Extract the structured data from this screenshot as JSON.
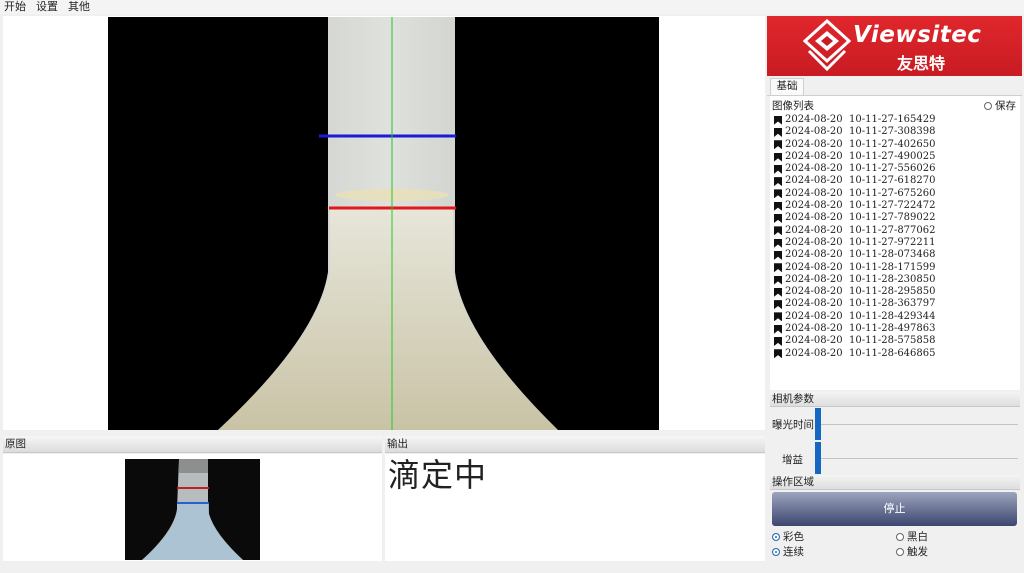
{
  "menu": {
    "items": [
      "开始",
      "设置",
      "其他"
    ]
  },
  "panels": {
    "original_label": "原图",
    "output_label": "输出"
  },
  "output": {
    "status_text": "滴定中"
  },
  "logo": {
    "text_en": "Viewsitec",
    "text_cn": "友思特"
  },
  "sidebar": {
    "tab_label": "基础",
    "image_list": {
      "title": "图像列表",
      "save_label": "保存",
      "items": [
        "2024-08-20  10-11-27-165429",
        "2024-08-20  10-11-27-308398",
        "2024-08-20  10-11-27-402650",
        "2024-08-20  10-11-27-490025",
        "2024-08-20  10-11-27-556026",
        "2024-08-20  10-11-27-618270",
        "2024-08-20  10-11-27-675260",
        "2024-08-20  10-11-27-722472",
        "2024-08-20  10-11-27-789022",
        "2024-08-20  10-11-27-877062",
        "2024-08-20  10-11-27-972211",
        "2024-08-20  10-11-28-073468",
        "2024-08-20  10-11-28-171599",
        "2024-08-20  10-11-28-230850",
        "2024-08-20  10-11-28-295850",
        "2024-08-20  10-11-28-363797",
        "2024-08-20  10-11-28-429344",
        "2024-08-20  10-11-28-497863",
        "2024-08-20  10-11-28-575858",
        "2024-08-20  10-11-28-646865"
      ]
    },
    "camera_params": {
      "title": "相机参数",
      "exposure_label": "曝光时间",
      "gain_label": "增益",
      "exposure_level": 0.0,
      "gain_level": 0.0
    },
    "operation": {
      "title": "操作区域",
      "stop_label": "停止",
      "color_label": "彩色",
      "mono_label": "黑白",
      "continuous_label": "连续",
      "trigger_label": "触发",
      "color_mode_selected": "彩色",
      "acquisition_mode_selected": "连续"
    }
  },
  "colors": {
    "logo_red": "#d42027",
    "upper_line": "#1a1ad8",
    "lower_line": "#e01818",
    "center_line": "#22cc22",
    "stop_button": "#4a5478",
    "radio_selected": "#2a6bb5"
  }
}
